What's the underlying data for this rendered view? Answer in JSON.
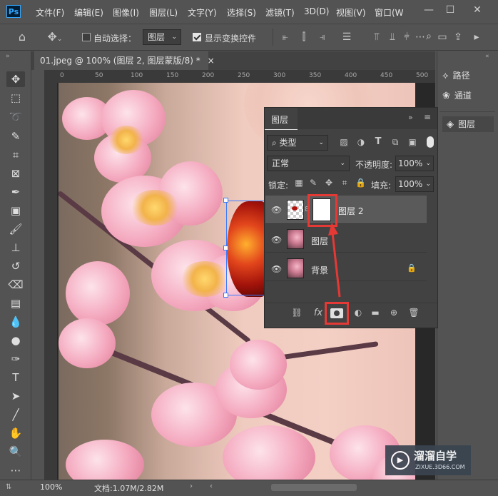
{
  "app": {
    "logo": "Ps"
  },
  "menu": [
    "文件(F)",
    "编辑(E)",
    "图像(I)",
    "图层(L)",
    "文字(Y)",
    "选择(S)",
    "滤镜(T)",
    "3D(D)",
    "视图(V)",
    "窗口(W"
  ],
  "window_controls": {
    "minimize": "—",
    "maximize": "☐",
    "close": "✕"
  },
  "options_bar": {
    "auto_select_label": "自动选择：",
    "auto_select_checked": false,
    "auto_select_target": "图层",
    "show_transform_label": "显示变换控件",
    "show_transform_checked": true
  },
  "document_tab": {
    "title": "01.jpeg @ 100% (图层 2, 图层蒙版/8) *",
    "close": "×"
  },
  "ruler_labels": [
    "0",
    "50",
    "100",
    "150",
    "200",
    "250",
    "300",
    "350",
    "400",
    "450",
    "500"
  ],
  "right_dock": {
    "paths": "路径",
    "channels": "通道",
    "layers": "图层"
  },
  "layers_panel": {
    "title": "图层",
    "filter_kind": "类型",
    "blend_mode": "正常",
    "opacity_label": "不透明度:",
    "opacity_value": "100%",
    "lock_label": "锁定:",
    "fill_label": "填充:",
    "fill_value": "100%",
    "layers": [
      {
        "name": "图层 2",
        "visible": true,
        "has_mask": true,
        "selected": true
      },
      {
        "name": "图层",
        "visible": true,
        "has_mask": false,
        "selected": false
      },
      {
        "name": "背景",
        "visible": true,
        "locked": true,
        "selected": false
      }
    ],
    "bottom_fx": "fx"
  },
  "status_bar": {
    "zoom": "100%",
    "doc_info": "文档:1.07M/2.82M"
  },
  "watermark": {
    "brand": "溜溜自学",
    "url": "ZIXUE.3D66.COM"
  },
  "colors": {
    "highlight": "#e53935",
    "ui_bg": "#535353",
    "panel_bg": "#424242"
  }
}
